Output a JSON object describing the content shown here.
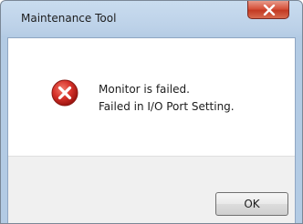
{
  "window": {
    "title": "Maintenance Tool",
    "close_icon": "close-x-icon"
  },
  "message": {
    "icon": "error-icon",
    "icon_color": "#c8261c",
    "line1": "Monitor is failed.",
    "line2": "Failed in I/O Port Setting."
  },
  "buttons": {
    "ok_label": "OK"
  }
}
